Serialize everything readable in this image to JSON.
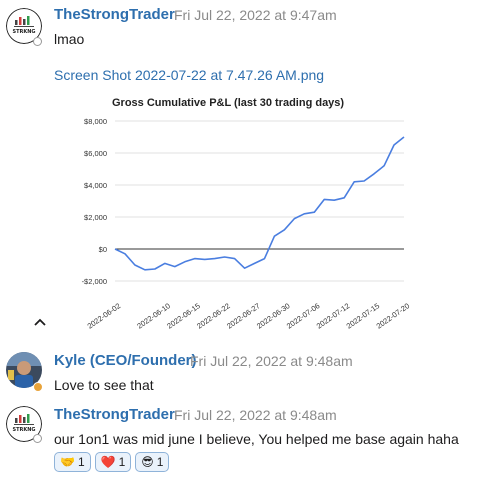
{
  "messages": [
    {
      "author": "TheStrongTrader",
      "timestamp": "Fri Jul 22, 2022 at 9:47am",
      "text": "lmao",
      "attachment": {
        "filename": "Screen Shot 2022-07-22 at 7.47.26 AM.png",
        "chart_data": {
          "type": "line",
          "title": "Gross Cumulative P&L (last 30 trading days)",
          "xlabel": "",
          "ylabel": "",
          "ylim": [
            -2000,
            8000
          ],
          "ytick_values": [
            -2000,
            0,
            2000,
            4000,
            6000,
            8000
          ],
          "ytick_labels": [
            "-$2,000",
            "$0",
            "$2,000",
            "$4,000",
            "$6,000",
            "$8,000"
          ],
          "xtick_labels": [
            "2022-06-02",
            "2022-06-10",
            "2022-06-15",
            "2022-06-22",
            "2022-06-27",
            "2022-06-30",
            "2022-07-06",
            "2022-07-12",
            "2022-07-15",
            "2022-07-20"
          ],
          "xtick_index": [
            0,
            5,
            8,
            11,
            14,
            17,
            20,
            23,
            26,
            29
          ],
          "grid": true,
          "line_color": "#4a7ee0",
          "series": [
            {
              "values": [
                0,
                -300,
                -1000,
                -1300,
                -1250,
                -900,
                -1100,
                -800,
                -600,
                -650,
                -600,
                -500,
                -600,
                -1200,
                -900,
                -600,
                800,
                1200,
                1900,
                2200,
                2300,
                3100,
                3050,
                3200,
                4200,
                4250,
                4700,
                5200,
                6500,
                7000
              ]
            }
          ]
        }
      },
      "collapse_icon": "chevron-up-icon"
    },
    {
      "author": "Kyle (CEO/Founder)",
      "timestamp": "Fri Jul 22, 2022 at 9:48am",
      "text": "Love to see that",
      "status": "away"
    },
    {
      "author": "TheStrongTrader",
      "timestamp": "Fri Jul 22, 2022 at 9:48am",
      "text": "our 1on1 was mid june I believe, You helped me base again haha",
      "reactions": [
        {
          "emoji": "🤝",
          "icon": "handshake-icon",
          "count": "1"
        },
        {
          "emoji": "❤️",
          "icon": "heart-icon",
          "count": "1"
        },
        {
          "emoji": "😎",
          "icon": "sunglasses-face-icon",
          "count": "1"
        }
      ]
    }
  ],
  "avatar_text": "STRKNG"
}
